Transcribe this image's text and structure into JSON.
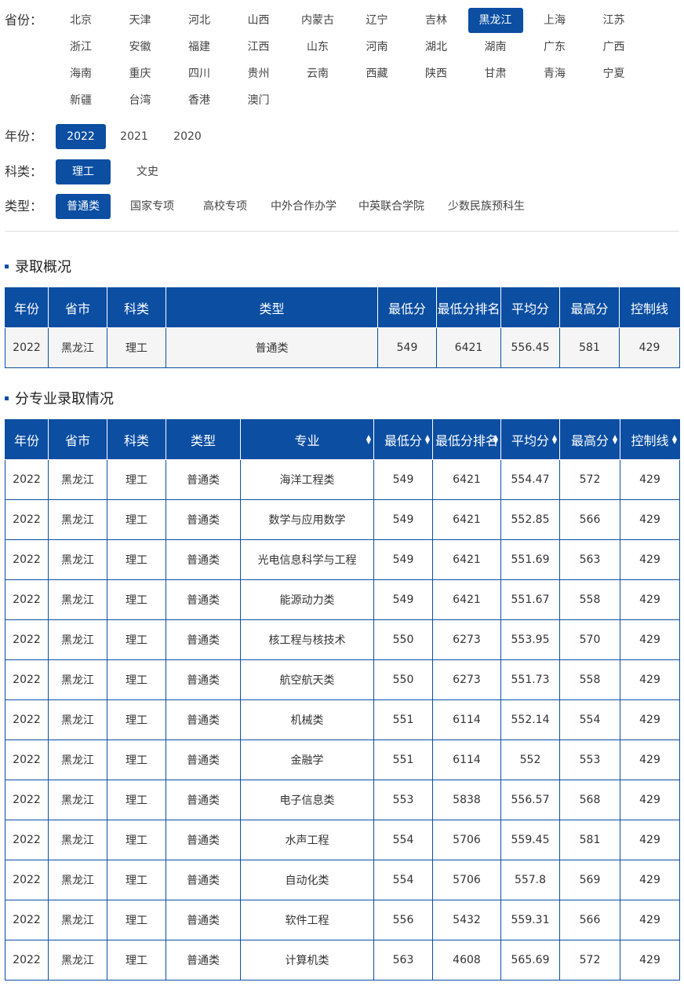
{
  "filters": {
    "province": {
      "label": "省份：",
      "options": [
        "北京",
        "天津",
        "河北",
        "山西",
        "内蒙古",
        "辽宁",
        "吉林",
        "黑龙江",
        "上海",
        "江苏",
        "浙江",
        "安徽",
        "福建",
        "江西",
        "山东",
        "河南",
        "湖北",
        "湖南",
        "广东",
        "广西",
        "海南",
        "重庆",
        "四川",
        "贵州",
        "云南",
        "西藏",
        "陕西",
        "甘肃",
        "青海",
        "宁夏",
        "新疆",
        "台湾",
        "香港",
        "澳门"
      ],
      "selected": "黑龙江"
    },
    "year": {
      "label": "年份：",
      "options": [
        "2022",
        "2021",
        "2020"
      ],
      "selected": "2022"
    },
    "subject": {
      "label": "科类：",
      "options": [
        "理工",
        "文史"
      ],
      "selected": "理工"
    },
    "type": {
      "label": "类型：",
      "options": [
        "普通类",
        "国家专项",
        "高校专项",
        "中外合作办学",
        "中英联合学院",
        "少数民族预科生"
      ],
      "selected": "普通类"
    }
  },
  "summary": {
    "title": "录取概况",
    "headers": [
      "年份",
      "省市",
      "科类",
      "类型",
      "最低分",
      "最低分排名",
      "平均分",
      "最高分",
      "控制线"
    ],
    "rows": [
      [
        "2022",
        "黑龙江",
        "理工",
        "普通类",
        "549",
        "6421",
        "556.45",
        "581",
        "429"
      ]
    ]
  },
  "majors": {
    "title": "分专业录取情况",
    "headers": [
      "年份",
      "省市",
      "科类",
      "类型",
      "专业",
      "最低分",
      "最低分排名",
      "平均分",
      "最高分",
      "控制线"
    ],
    "sortable": [
      false,
      false,
      false,
      false,
      true,
      true,
      true,
      true,
      true,
      true
    ],
    "rows": [
      [
        "2022",
        "黑龙江",
        "理工",
        "普通类",
        "海洋工程类",
        "549",
        "6421",
        "554.47",
        "572",
        "429"
      ],
      [
        "2022",
        "黑龙江",
        "理工",
        "普通类",
        "数学与应用数学",
        "549",
        "6421",
        "552.85",
        "566",
        "429"
      ],
      [
        "2022",
        "黑龙江",
        "理工",
        "普通类",
        "光电信息科学与工程",
        "549",
        "6421",
        "551.69",
        "563",
        "429"
      ],
      [
        "2022",
        "黑龙江",
        "理工",
        "普通类",
        "能源动力类",
        "549",
        "6421",
        "551.67",
        "558",
        "429"
      ],
      [
        "2022",
        "黑龙江",
        "理工",
        "普通类",
        "核工程与核技术",
        "550",
        "6273",
        "553.95",
        "570",
        "429"
      ],
      [
        "2022",
        "黑龙江",
        "理工",
        "普通类",
        "航空航天类",
        "550",
        "6273",
        "551.73",
        "558",
        "429"
      ],
      [
        "2022",
        "黑龙江",
        "理工",
        "普通类",
        "机械类",
        "551",
        "6114",
        "552.14",
        "554",
        "429"
      ],
      [
        "2022",
        "黑龙江",
        "理工",
        "普通类",
        "金融学",
        "551",
        "6114",
        "552",
        "553",
        "429"
      ],
      [
        "2022",
        "黑龙江",
        "理工",
        "普通类",
        "电子信息类",
        "553",
        "5838",
        "556.57",
        "568",
        "429"
      ],
      [
        "2022",
        "黑龙江",
        "理工",
        "普通类",
        "水声工程",
        "554",
        "5706",
        "559.45",
        "581",
        "429"
      ],
      [
        "2022",
        "黑龙江",
        "理工",
        "普通类",
        "自动化类",
        "554",
        "5706",
        "557.8",
        "569",
        "429"
      ],
      [
        "2022",
        "黑龙江",
        "理工",
        "普通类",
        "软件工程",
        "556",
        "5432",
        "559.31",
        "566",
        "429"
      ],
      [
        "2022",
        "黑龙江",
        "理工",
        "普通类",
        "计算机类",
        "563",
        "4608",
        "565.69",
        "572",
        "429"
      ]
    ]
  },
  "colors": {
    "accent": "#0b4ea2"
  }
}
